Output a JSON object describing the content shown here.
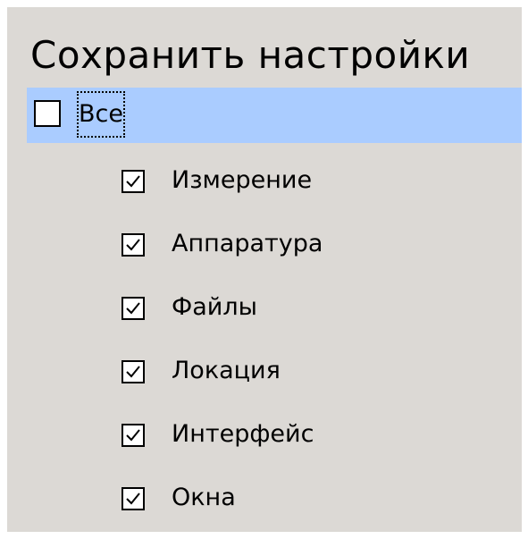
{
  "header": {
    "title": "Сохранить настройки"
  },
  "all_option": {
    "label": "Все",
    "checked": false
  },
  "items": [
    {
      "label": "Измерение",
      "checked": true
    },
    {
      "label": "Аппаратура",
      "checked": true
    },
    {
      "label": "Файлы",
      "checked": true
    },
    {
      "label": "Локация",
      "checked": true
    },
    {
      "label": "Интерфейс",
      "checked": true
    },
    {
      "label": "Окна",
      "checked": true
    }
  ],
  "colors": {
    "panel_background": "#dcd9d5",
    "selected_row": "#aaccff",
    "checkbox_fill": "#ffffff"
  }
}
